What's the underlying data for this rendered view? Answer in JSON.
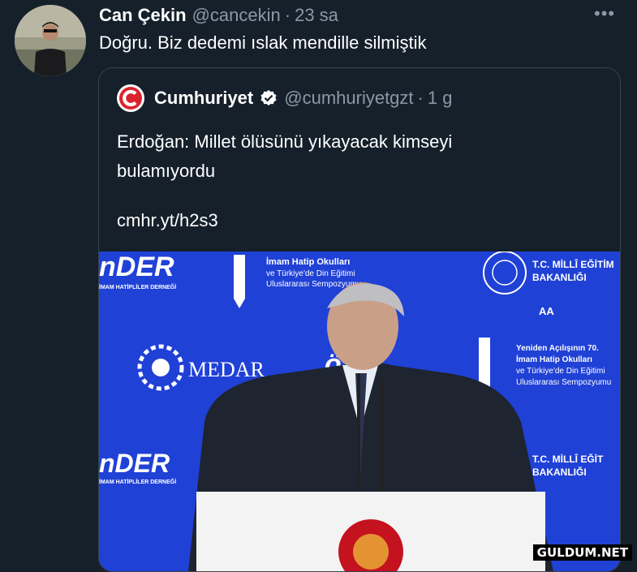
{
  "tweet": {
    "author_name": "Can Çekin",
    "author_handle": "@cancekin",
    "separator": "·",
    "time": "23 sa",
    "text": "Doğru. Biz dedemi ıslak mendille silmiştik",
    "more_icon": "more-icon"
  },
  "quote": {
    "author_name": "Cumhuriyet",
    "author_handle": "@cumhuriyetgzt",
    "separator": "·",
    "time": "1 g",
    "verified": true,
    "text_line1": "Erdoğan: Millet ölüsünü yıkayacak kimseyi",
    "text_line2": "bulamıyordu",
    "link": "cmhr.yt/h2s3",
    "logo_letter": "C",
    "brand_color": "#d9232d"
  },
  "media": {
    "banner": {
      "onder_logo": "nDER",
      "onder_sub": "İMAM HATİPLİLER DERNEĞİ",
      "imam_title": "İmam Hatip Okulları",
      "imam_sub1": "ve Türkiye'de Din Eğitimi",
      "imam_sub2": "Uluslararası Sempozyumu",
      "medar": "MEDAR",
      "meb_line1": "T.C. MİLLÎ EĞİTİM",
      "meb_line2": "BAKANLIĞI",
      "aa": "AA",
      "reopen_line1": "Yeniden Açılışının 70.",
      "reopen_line2": "İmam Hatip Okulları",
      "reopen_line3": "ve Türkiye'de Din Eğitimi",
      "reopen_line4": "Uluslararası Sempozyumu"
    }
  },
  "watermark": "GULDUM.NET",
  "colors": {
    "background": "#15202b",
    "border": "#38444d",
    "muted": "#8b98a5",
    "banner_blue": "#1f3fd4",
    "verified_blue": "#1d9bf0"
  }
}
